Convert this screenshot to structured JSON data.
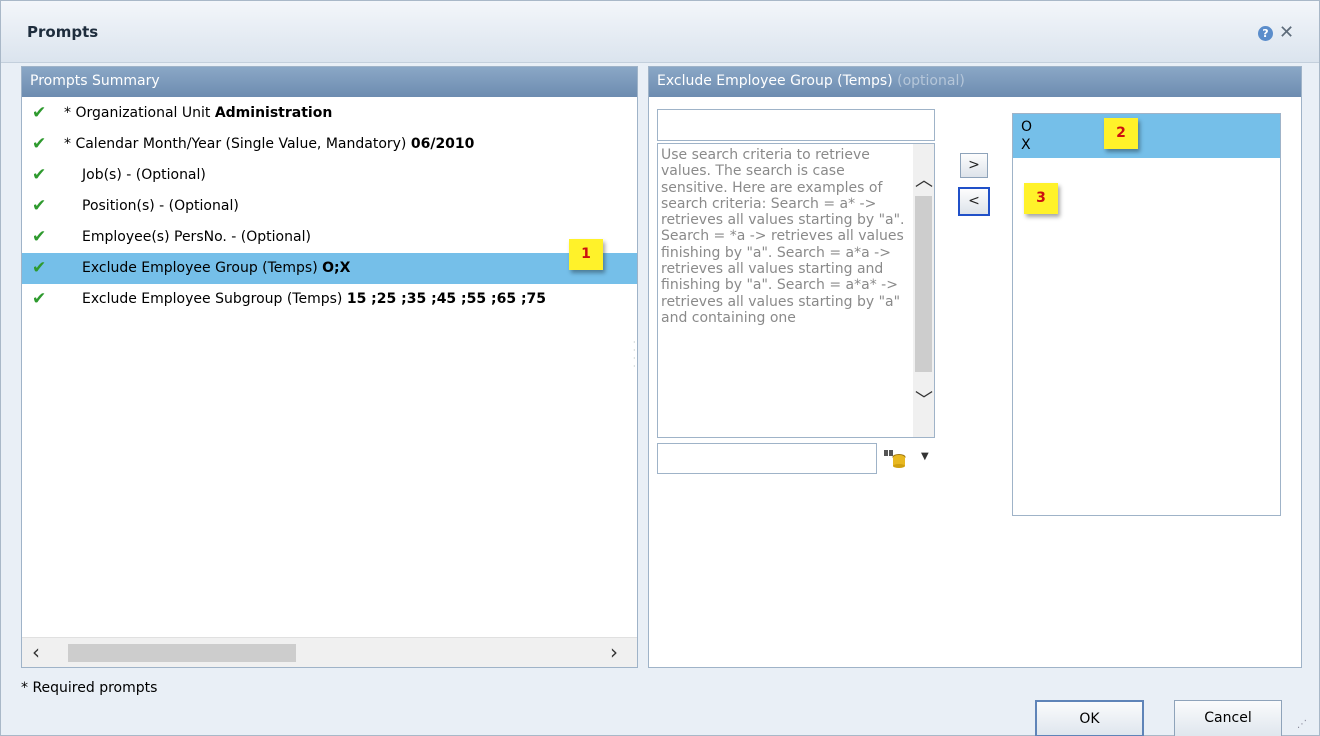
{
  "dialog": {
    "title": "Prompts",
    "help_icon": "question-circle-icon",
    "close_icon": "close-x-icon"
  },
  "summary": {
    "header": "Prompts Summary",
    "rows": [
      {
        "label": "* Organizational Unit ",
        "value": "Administration",
        "selected": false
      },
      {
        "label": "* Calendar Month/Year (Single Value, Mandatory) ",
        "value": "06/2010",
        "selected": false
      },
      {
        "label": "Job(s) - (Optional)",
        "value": "",
        "selected": false
      },
      {
        "label": "Position(s) - (Optional)",
        "value": "",
        "selected": false
      },
      {
        "label": "Employee(s) PersNo. - (Optional)",
        "value": "",
        "selected": false
      },
      {
        "label": "Exclude Employee Group (Temps) ",
        "value": "O;X",
        "selected": true
      },
      {
        "label": "Exclude Employee Subgroup (Temps) ",
        "value": "15 ;25 ;35 ;45 ;55 ;65 ;75",
        "selected": false
      }
    ]
  },
  "exclude_panel": {
    "header": "Exclude Employee Group (Temps)",
    "header_optional": "(optional)",
    "search_top_value": "",
    "help_text": "Use search criteria to retrieve values. The search is case sensitive. Here are examples of search criteria: Search = a* -> retrieves all values starting by \"a\". Search = *a -> retrieves all values finishing by \"a\". Search = a*a -> retrieves all values starting and finishing by \"a\". Search = a*a* -> retrieves all values starting by \"a\" and containing one",
    "search_bottom_value": "",
    "add_button": ">",
    "remove_button": "<",
    "selected_values": [
      "O",
      "X"
    ]
  },
  "callouts": [
    "1",
    "2",
    "3"
  ],
  "footer": {
    "required_note": "* Required prompts",
    "ok": "OK",
    "cancel": "Cancel"
  },
  "colors": {
    "selection": "#75bfe9",
    "panel_header": "#7896b8",
    "check": "#2e9a2e",
    "callout_bg": "#fff22a",
    "callout_text": "#cc1010"
  }
}
